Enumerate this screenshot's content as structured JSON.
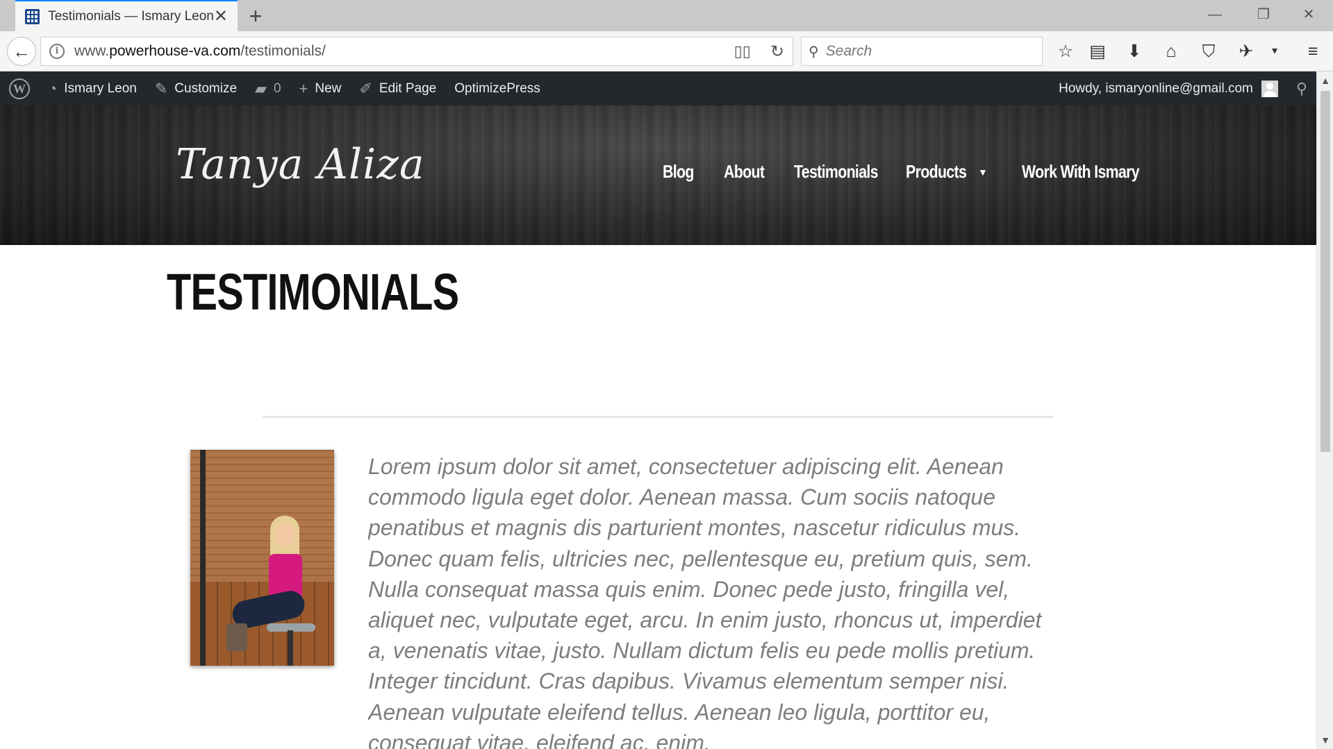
{
  "browser": {
    "tab_title": "Testimonials — Ismary Leon",
    "url_prefix": "www.",
    "url_domain": "powerhouse-va.com",
    "url_path": "/testimonials/",
    "search_placeholder": "Search"
  },
  "admin_bar": {
    "site_name": "Ismary Leon",
    "customize": "Customize",
    "comments_count": "0",
    "new": "New",
    "edit_page": "Edit Page",
    "optimizepress": "OptimizePress",
    "howdy": "Howdy, ismaryonline@gmail.com"
  },
  "header": {
    "logo": "Tanya Aliza",
    "nav": {
      "blog": "Blog",
      "about": "About",
      "testimonials": "Testimonials",
      "products": "Products",
      "work": "Work With Ismary"
    }
  },
  "content": {
    "page_title": "TESTIMONIALS",
    "quote": "Lorem ipsum dolor sit amet, consectetuer adipiscing elit. Aenean commodo ligula eget dolor. Aenean massa. Cum sociis natoque penatibus et magnis dis parturient montes, nascetur ridiculus mus. Donec quam felis, ultricies nec, pellentesque eu, pretium quis, sem. Nulla consequat massa quis enim. Donec pede justo, fringilla vel, aliquet nec, vulputate eget, arcu. In enim justo, rhoncus ut, imperdiet a, venenatis vitae, justo. Nullam dictum felis eu pede mollis pretium. Integer tincidunt. Cras dapibus. Vivamus elementum semper nisi. Aenean vulputate eleifend tellus. Aenean leo ligula, porttitor eu, consequat vitae, eleifend ac, enim."
  },
  "colors": {
    "admin_bar_bg": "#23282d",
    "quote_text": "#7d7d7d",
    "title_text": "#111111"
  }
}
